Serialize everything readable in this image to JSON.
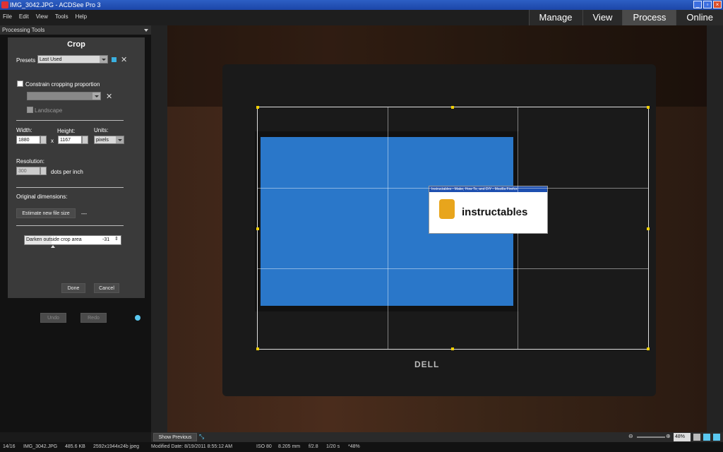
{
  "window": {
    "title": "IMG_3042.JPG - ACDSee Pro 3"
  },
  "menu": [
    "File",
    "Edit",
    "View",
    "Tools",
    "Help"
  ],
  "modes": [
    "Manage",
    "View",
    "Process",
    "Online"
  ],
  "active_mode": "Process",
  "panel": {
    "header": "Processing Tools",
    "title": "Crop",
    "presets_label": "Presets",
    "presets_value": "Last Used",
    "constrain_label": "Constrain cropping proportion",
    "landscape_label": "Landscape",
    "width_label": "Width:",
    "width_value": "1880",
    "x_label": "x",
    "height_label": "Height:",
    "height_value": "1167",
    "units_label": "Units:",
    "units_value": "pixels",
    "resolution_label": "Resolution:",
    "resolution_value": "300",
    "resolution_unit": "dots per inch",
    "original_dims_label": "Original dimensions:",
    "estimate_button": "Estimate new file size",
    "estimate_value": "---",
    "darken_label": "Darken outside crop area",
    "darken_value": "-31",
    "done_button": "Done",
    "cancel_button": "Cancel",
    "undo_button": "Undo",
    "redo_button": "Redo"
  },
  "photo": {
    "overlay_text": "instructables",
    "window_caption": "Instructables - Make, How To, and DIY - Mozilla Firefox",
    "monitor_brand": "DELL"
  },
  "viewer_toolbar": {
    "show_previous": "Show Previous",
    "zoom": "48%"
  },
  "status": {
    "index": "14/16",
    "filename": "IMG_3042.JPG",
    "size": "485.6 KB",
    "dims": "2592x1944x24b jpeg",
    "modified": "Modified Date: 8/19/2011 8:55:12 AM",
    "iso": "ISO 80",
    "focal": "8.205 mm",
    "aperture": "f/2.8",
    "shutter": "1/20 s",
    "zoom": "*48%"
  }
}
